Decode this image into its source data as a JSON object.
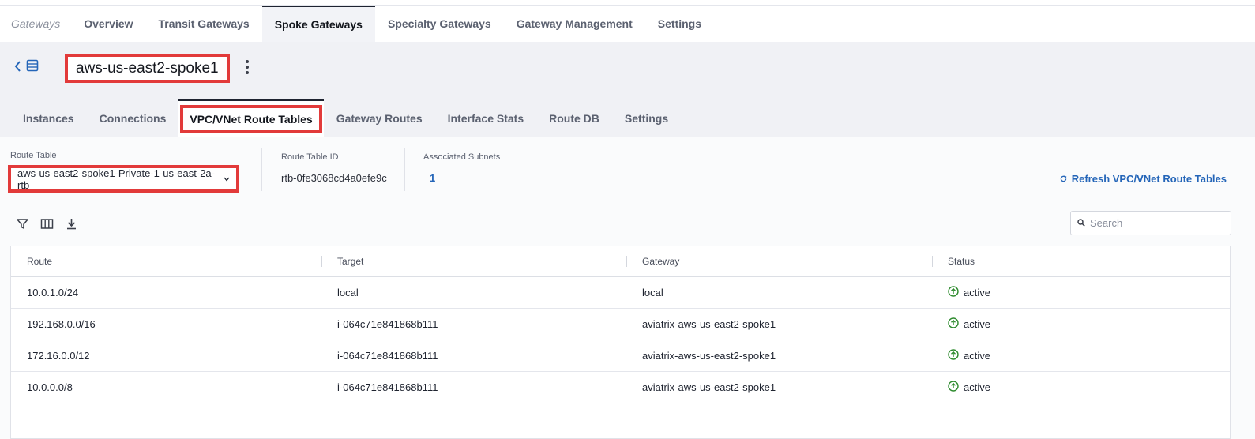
{
  "nav": {
    "crumb": "Gateways",
    "tabs": [
      {
        "label": "Overview"
      },
      {
        "label": "Transit Gateways"
      },
      {
        "label": "Spoke Gateways"
      },
      {
        "label": "Specialty Gateways"
      },
      {
        "label": "Gateway Management"
      },
      {
        "label": "Settings"
      }
    ],
    "active_tab": "Spoke Gateways"
  },
  "gateway": {
    "name": "aws-us-east2-spoke1"
  },
  "subtabs": [
    {
      "label": "Instances"
    },
    {
      "label": "Connections"
    },
    {
      "label": "VPC/VNet Route Tables"
    },
    {
      "label": "Gateway Routes"
    },
    {
      "label": "Interface Stats"
    },
    {
      "label": "Route DB"
    },
    {
      "label": "Settings"
    }
  ],
  "controls": {
    "route_table_label": "Route Table",
    "route_table_value": "aws-us-east2-spoke1-Private-1-us-east-2a-rtb",
    "route_table_id_label": "Route Table ID",
    "route_table_id": "rtb-0fe3068cd4a0efe9c",
    "assoc_subnets_label": "Associated Subnets",
    "assoc_subnets": "1",
    "refresh_label": "Refresh VPC/VNet Route Tables",
    "search_placeholder": "Search"
  },
  "table": {
    "columns": [
      "Route",
      "Target",
      "Gateway",
      "Status"
    ],
    "rows": [
      {
        "route": "10.0.1.0/24",
        "target": "local",
        "gateway": "local",
        "status": "active"
      },
      {
        "route": "192.168.0.0/16",
        "target": "i-064c71e841868b111",
        "gateway": "aviatrix-aws-us-east2-spoke1",
        "status": "active"
      },
      {
        "route": "172.16.0.0/12",
        "target": "i-064c71e841868b111",
        "gateway": "aviatrix-aws-us-east2-spoke1",
        "status": "active"
      },
      {
        "route": "10.0.0.0/8",
        "target": "i-064c71e841868b111",
        "gateway": "aviatrix-aws-us-east2-spoke1",
        "status": "active"
      }
    ]
  },
  "colors": {
    "accent": "#2465b8",
    "highlight": "#e23a3a",
    "status_active": "#2e8b2e"
  },
  "icons": [
    "chevron-left-icon",
    "list-icon",
    "kebab-menu-icon",
    "chevron-down-icon",
    "refresh-icon",
    "filter-icon",
    "columns-icon",
    "download-icon",
    "search-icon",
    "status-active-icon"
  ]
}
